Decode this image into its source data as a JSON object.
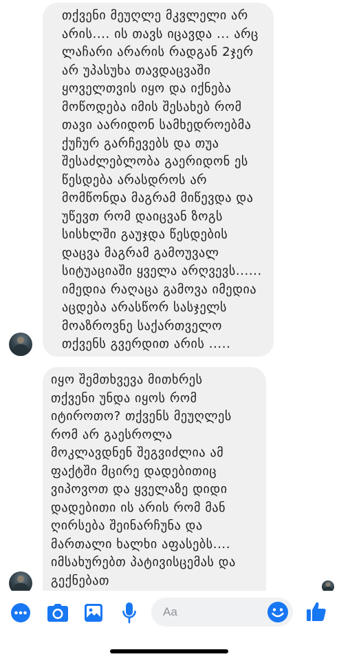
{
  "messages": [
    {
      "sender": "other",
      "text": "თქვენი მეუღლე მკვლელი არ\nარის.... ის თავს იცავდა ... არც\nლაჩარი არარის რადგან 2ჯერ\nარ უპასუხა თავდაცვაში\nყოველთვის იყო და იქნება\nმოწოდება იმის შესახებ რომ\nთავი აარიდონ სამხედროებმა\nქუჩურ გარჩევებს და თუა\nშესაძლებლობა გაერიდონ ეს\nწესდება არასდროს არ\nმომწონდა მაგრამ მიწევდა და\nუწევთ რომ დაიცვან ზოგს\nსისხლში გაუჯდა წესდების\nდაცვა მაგრამ გამოუვალ\nსიტუაციაში ყველა არღვევს......\nიმედია რაღაცა გამოვა იმედია\nაცდება არასწორ სასჯელს\nმოაზროვნე საქართველო\nთქვენს გვერდით არის ....."
    },
    {
      "sender": "other",
      "text": "იყო შემთხვევა მითხრეს\nთქვენი უნდა იყოს რომ\nიტიროთო? თქვენს მეუღლეს\nრომ არ გაესროლა\nმოკლავდნენ შეგვიძლია ამ\nფაქტში მცირე დადებითიც\nვიპოვოთ და  ყველაზე დიდი\nდადებითი ის არის რომ მან\nღირსება შეინარჩუნა და\nმართალი ხალხი აფასებს....\nიმსახურებთ პატივისცემას და\nგექნებათ"
    }
  ],
  "composer": {
    "placeholder": "Aa",
    "accent_color": "#1877f2"
  },
  "icons": {
    "more": "more-dots-icon",
    "camera": "camera-icon",
    "photo": "photo-gallery-icon",
    "mic": "microphone-icon",
    "emoji": "smiley-emoji-icon",
    "like": "thumbs-up-icon"
  }
}
